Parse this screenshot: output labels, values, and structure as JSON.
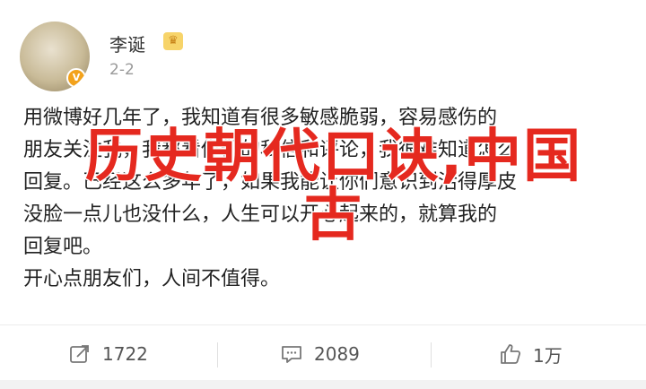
{
  "user": {
    "name": "李诞",
    "time": "2-2",
    "avatar_icon": "avatar-portrait",
    "badge_icon": "verified-v-icon",
    "crown_icon": "crown-icon"
  },
  "post": {
    "lines": [
      "用微博好几年了，我知道有很多敏感脆弱，容易感伤的",
      "朋友关注我，我都看你们的私信和评论，我很难知道怎么",
      "回复。已经这么多年了，如果我能让你们意识到活得厚皮",
      "没脸一点儿也没什么，人生可以开心起来的，就算我的",
      "回复吧。",
      "开心点朋友们，人间不值得。"
    ]
  },
  "overlay": {
    "line1": "历史朝代口诀,中国",
    "line2": "古"
  },
  "actions": {
    "repost_count": "1722",
    "comment_count": "2089",
    "like_count": "1万"
  },
  "colors": {
    "overlay_red": "#e5291f",
    "text": "#222222"
  }
}
